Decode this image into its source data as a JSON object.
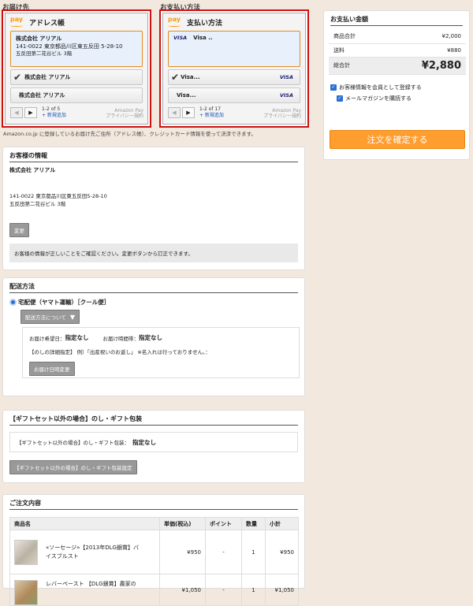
{
  "shipping_widget": {
    "section_label": "お届け先",
    "title": "アドレス帳",
    "selected": {
      "name": "株式会社 アリアル",
      "line1": "141-0022 東京都品川区東五反田 5-28-10",
      "line2": "五反田第二花谷ビル 3階"
    },
    "options": [
      "株式会社 アリアル",
      "株式会社 アリアル"
    ],
    "pager_count": "1-2 of 5",
    "add_new": "+ 新規追加",
    "note_line1": "Amazon Pay",
    "note_line2": "プライバシー規約"
  },
  "payment_widget": {
    "section_label": "お支払い方法",
    "title": "支払い方法",
    "selected": {
      "brand": "VISA",
      "text": "Visa .."
    },
    "options": [
      {
        "text": "Visa...",
        "brand": "VISA"
      },
      {
        "text": "Visa...",
        "brand": "VISA"
      }
    ],
    "pager_count": "1-2 of 17",
    "add_new": "+ 新規追加",
    "note_line1": "Amazon Pay",
    "note_line2": "プライバシー規約"
  },
  "amazon_note": "Amazon.co.jp に登録しているお届け先ご住所（アドレス帳）、クレジットカード情報を使って決済できます。",
  "customer": {
    "title": "お客様の情報",
    "name": "株式会社 アリアル",
    "addr1": "141-0022 東京都品川区東五反田5-28-10",
    "addr2": "五反田第二花谷ビル 3階",
    "change_button": "変更",
    "confirm_text": "お客様の情報が正しいことをご確認ください。変更ボタンから訂正できます。"
  },
  "delivery": {
    "title": "配送方法",
    "method": "宅配便（ヤマト運輸）［クール便］",
    "about_button": "配送方法について",
    "date_label": "お届け希望日：",
    "date_value": "指定なし",
    "time_label": "お届け時間帯：",
    "time_value": "指定なし",
    "noshi_note": "【のしの詳細指定】 例）「出産祝いのお返し」 ※名入れは行っておりません。：",
    "change_date_button": "お届け日時変更"
  },
  "gift": {
    "title": "【ギフトセット以外の場合】のし・ギフト包装",
    "current_label": "【ギフトセット以外の場合】のし・ギフト包装：",
    "current_value": "指定なし",
    "settings_button": "【ギフトセット以外の場合】のし・ギフト包装設定"
  },
  "order": {
    "title": "ご注文内容",
    "headers": [
      "商品名",
      "単価(税込)",
      "ポイント",
      "数量",
      "小計"
    ],
    "rows": [
      {
        "name_line1": "«ソーセージ»【2013年DLG銀賞】バ",
        "name_line2": "イスブルスト",
        "price": "¥950",
        "points": "-",
        "qty": "1",
        "subtotal": "¥950"
      },
      {
        "name_line1": "レバーペースト 【DLG銀賞】農家の",
        "name_line2": "",
        "price": "¥1,050",
        "points": "-",
        "qty": "1",
        "subtotal": "¥1,050"
      }
    ]
  },
  "summary": {
    "title": "お支払い金額",
    "items": [
      {
        "label": "商品合計",
        "value": "¥2,000"
      },
      {
        "label": "送料",
        "value": "¥880"
      }
    ],
    "total_label": "総合計",
    "total_value": "¥2,880",
    "register_label": "お客様情報を会員として登録する",
    "newsletter_label": "メールマガジンを購読する",
    "confirm_button": "注文を確定する"
  },
  "colors": {
    "accent": "#ff9900",
    "frame": "#cc1111",
    "background": "#f3e8de"
  }
}
